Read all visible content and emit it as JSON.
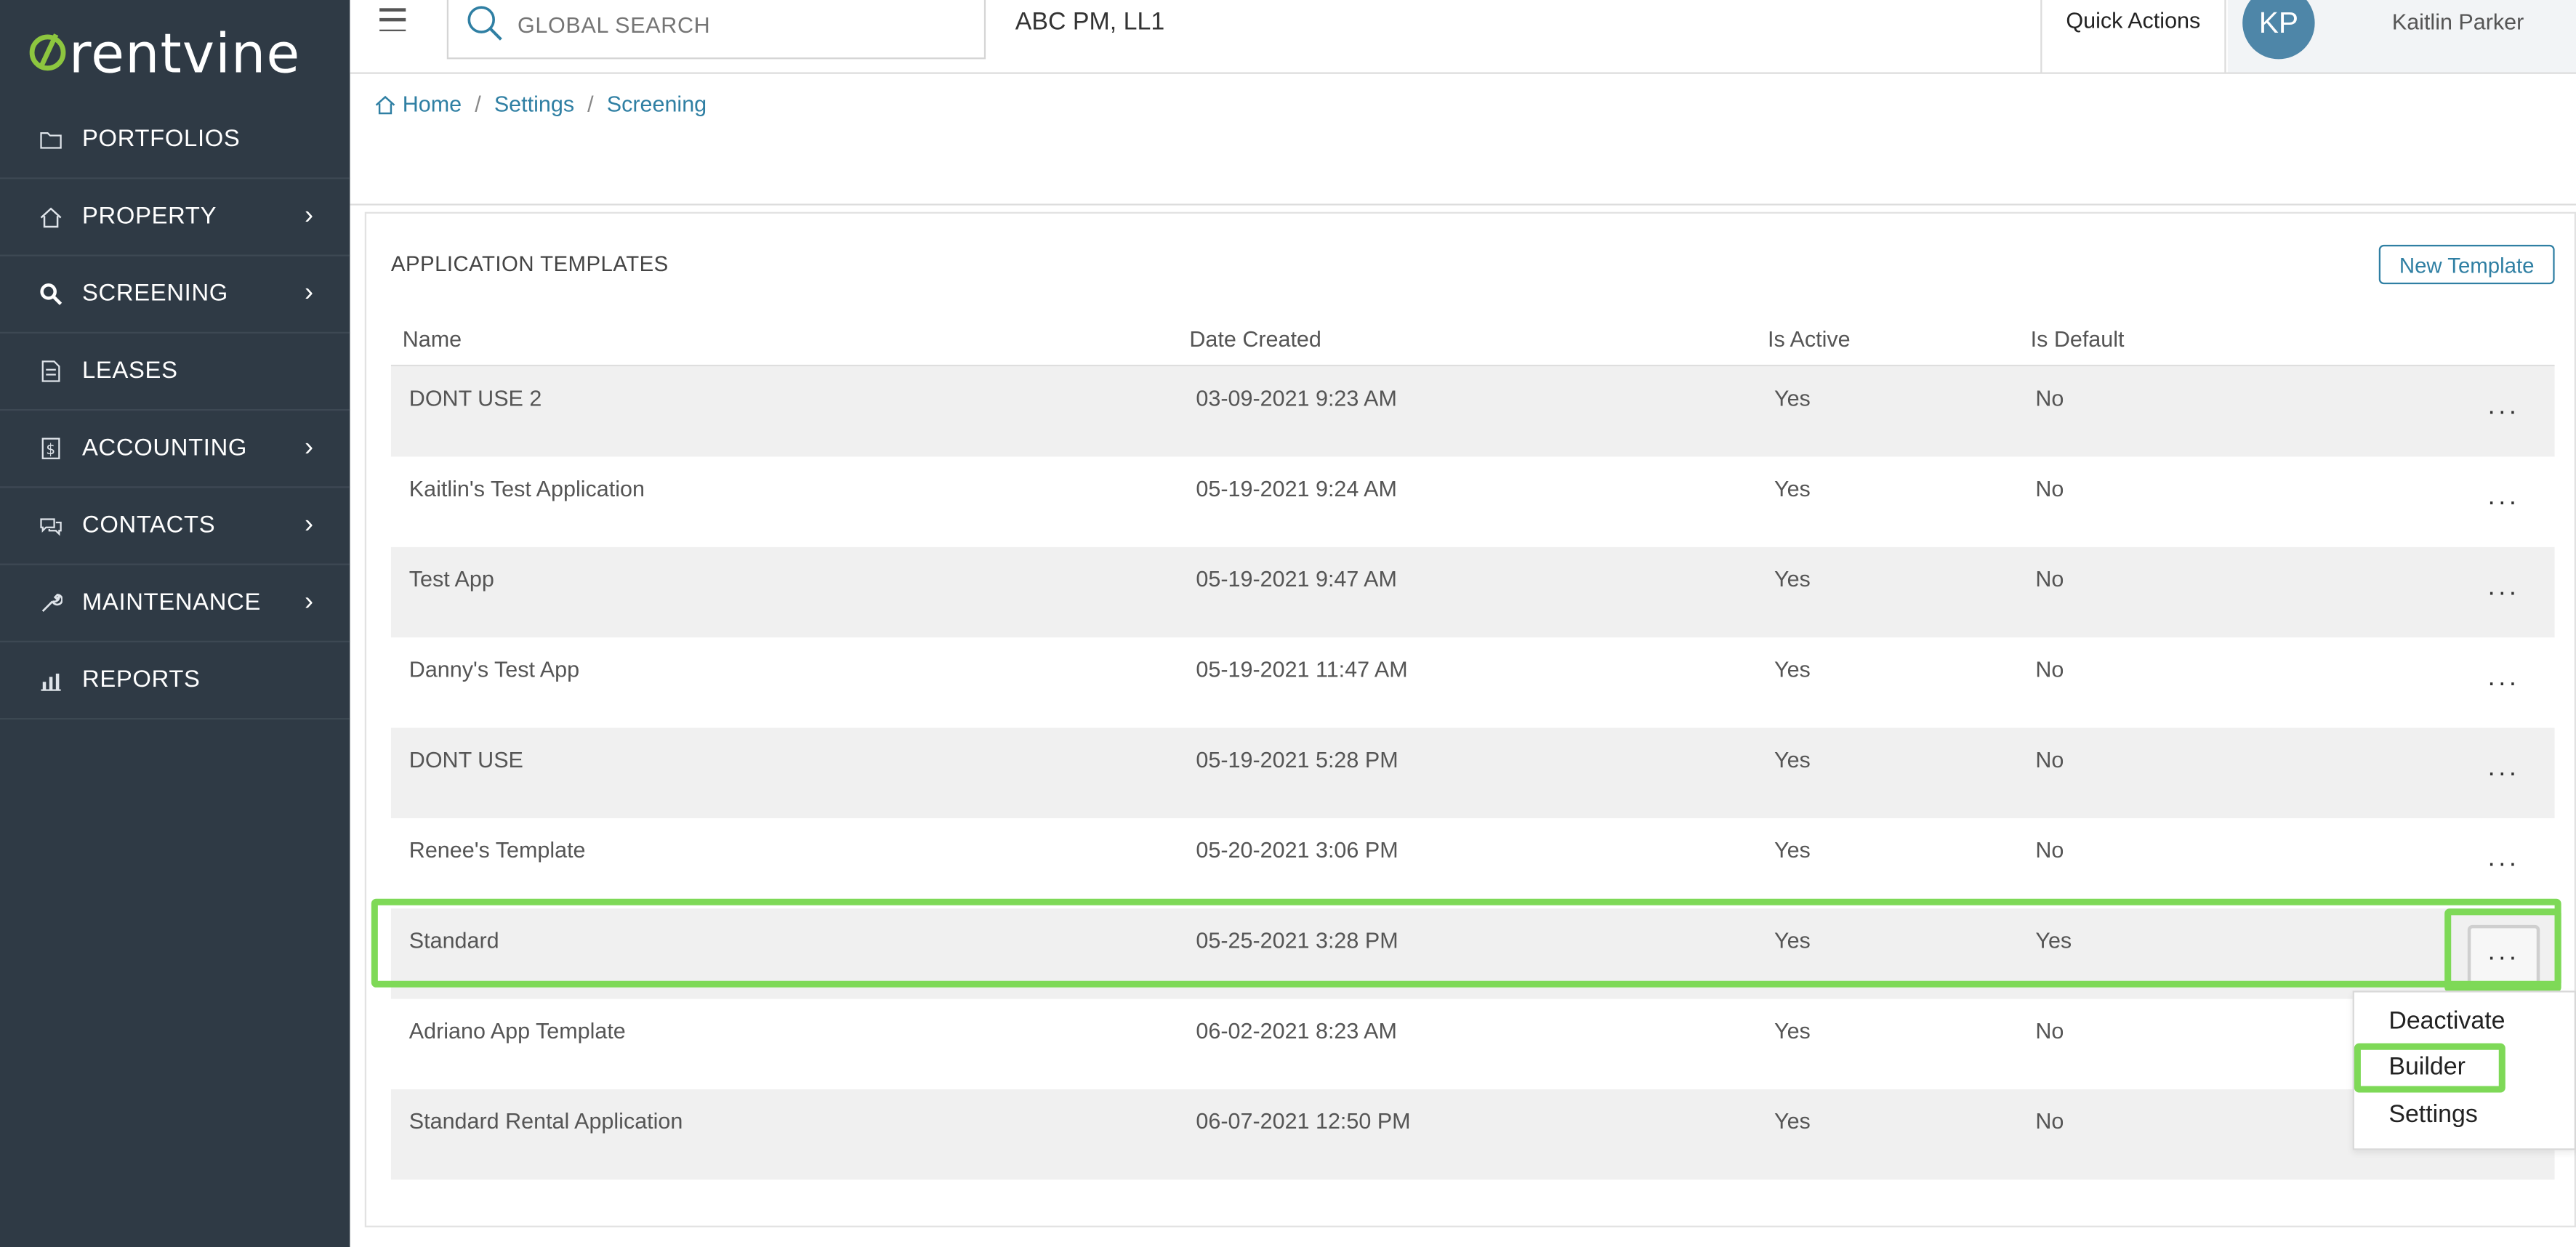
{
  "brand": {
    "logo_text": "rentvine",
    "logo_accent": "#8dc63f",
    "sidebar_bg": "#2f3a45",
    "link_color": "#2f7fa3",
    "highlight_color": "#7ed957"
  },
  "sidebar": {
    "items": [
      {
        "label": "PORTFOLIOS",
        "icon": "folder-icon",
        "has_chevron": false
      },
      {
        "label": "PROPERTY",
        "icon": "home-icon",
        "has_chevron": true
      },
      {
        "label": "SCREENING",
        "icon": "search-icon",
        "has_chevron": true
      },
      {
        "label": "LEASES",
        "icon": "document-icon",
        "has_chevron": false
      },
      {
        "label": "ACCOUNTING",
        "icon": "dollar-icon",
        "has_chevron": true
      },
      {
        "label": "CONTACTS",
        "icon": "chat-icon",
        "has_chevron": true
      },
      {
        "label": "MAINTENANCE",
        "icon": "wrench-icon",
        "has_chevron": true
      },
      {
        "label": "REPORTS",
        "icon": "chart-icon",
        "has_chevron": false
      }
    ],
    "chevron": "›"
  },
  "topbar": {
    "search_placeholder": "GLOBAL SEARCH",
    "company": "ABC PM, LL1",
    "quick_actions": "Quick Actions",
    "avatar_initials": "KP",
    "user_name": "Kaitlin Parker"
  },
  "breadcrumb": {
    "home": "Home",
    "settings": "Settings",
    "screening": "Screening",
    "separator": "/"
  },
  "card": {
    "title": "APPLICATION TEMPLATES",
    "new_button": "New Template",
    "columns": {
      "name": "Name",
      "date": "Date Created",
      "active": "Is Active",
      "default": "Is Default"
    },
    "rows": [
      {
        "name": "DONT USE 2",
        "date": "03-09-2021 9:23 AM",
        "active": "Yes",
        "default": "No"
      },
      {
        "name": "Kaitlin's Test Application",
        "date": "05-19-2021 9:24 AM",
        "active": "Yes",
        "default": "No"
      },
      {
        "name": "Test App",
        "date": "05-19-2021 9:47 AM",
        "active": "Yes",
        "default": "No"
      },
      {
        "name": "Danny's Test App",
        "date": "05-19-2021 11:47 AM",
        "active": "Yes",
        "default": "No"
      },
      {
        "name": "DONT USE",
        "date": "05-19-2021 5:28 PM",
        "active": "Yes",
        "default": "No"
      },
      {
        "name": "Renee's Template",
        "date": "05-20-2021 3:06 PM",
        "active": "Yes",
        "default": "No"
      },
      {
        "name": "Standard",
        "date": "05-25-2021 3:28 PM",
        "active": "Yes",
        "default": "Yes"
      },
      {
        "name": "Adriano App Template",
        "date": "06-02-2021 8:23 AM",
        "active": "Yes",
        "default": "No"
      },
      {
        "name": "Standard Rental Application",
        "date": "06-07-2021 12:50 PM",
        "active": "Yes",
        "default": "No"
      }
    ],
    "row_menu_label": "..."
  },
  "dropdown": {
    "deactivate": "Deactivate",
    "builder": "Builder",
    "settings": "Settings"
  }
}
